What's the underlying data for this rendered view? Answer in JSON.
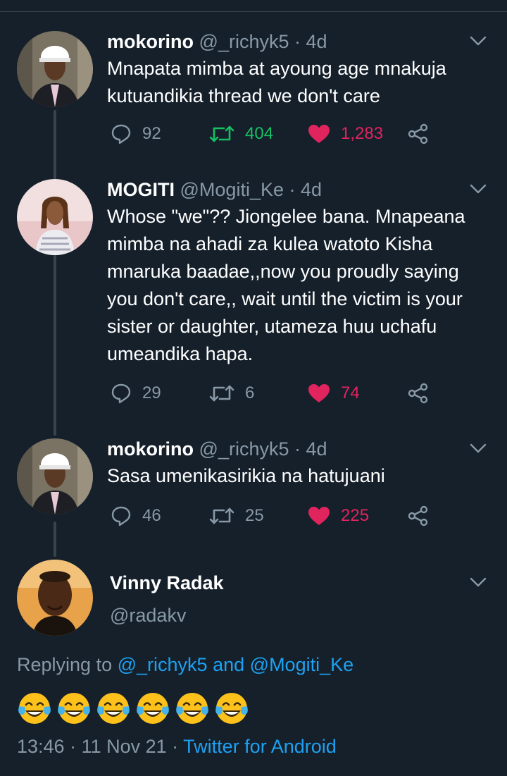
{
  "tweets": [
    {
      "name": "mokorino",
      "handle": "@_richyk5 · 4d",
      "text": "Mnapata mimba at ayoung age mnakuja kutuandikia thread we don't care",
      "replies": "92",
      "retweets": "404",
      "likes": "1,283"
    },
    {
      "name": "MOGITI",
      "handle": "@Mogiti_Ke · 4d",
      "text": "Whose \"we\"?? Jiongelee bana. Mnapeana mimba na ahadi za kulea watoto Kisha mnaruka baadae,,now you proudly saying you don't care,, wait until the victim is your sister or daughter, utameza huu uchafu umeandika hapa.",
      "replies": "29",
      "retweets": "6",
      "likes": "74"
    },
    {
      "name": "mokorino",
      "handle": "@_richyk5 · 4d",
      "text": "Sasa umenikasirikia na hatujuani",
      "replies": "46",
      "retweets": "25",
      "likes": "225"
    }
  ],
  "main_tweet": {
    "name": "Vinny Radak",
    "handle": "@radakv",
    "replying_prefix": "Replying to",
    "replying_user1": "@_richyk5",
    "replying_and": "and",
    "replying_user2": "@Mogiti_Ke",
    "emojis": [
      "face-with-tears-of-joy",
      "face-with-tears-of-joy",
      "face-with-tears-of-joy",
      "face-with-tears-of-joy",
      "face-with-tears-of-joy",
      "face-with-tears-of-joy"
    ],
    "time": "13:46",
    "date": "11 Nov 21",
    "source": "Twitter for Android"
  },
  "colors": {
    "background": "#15202b",
    "secondary_text": "#8899a6",
    "link": "#1da1f2",
    "retweet_active": "#17bf63",
    "like_active": "#e0245e",
    "divider": "#38444d"
  }
}
